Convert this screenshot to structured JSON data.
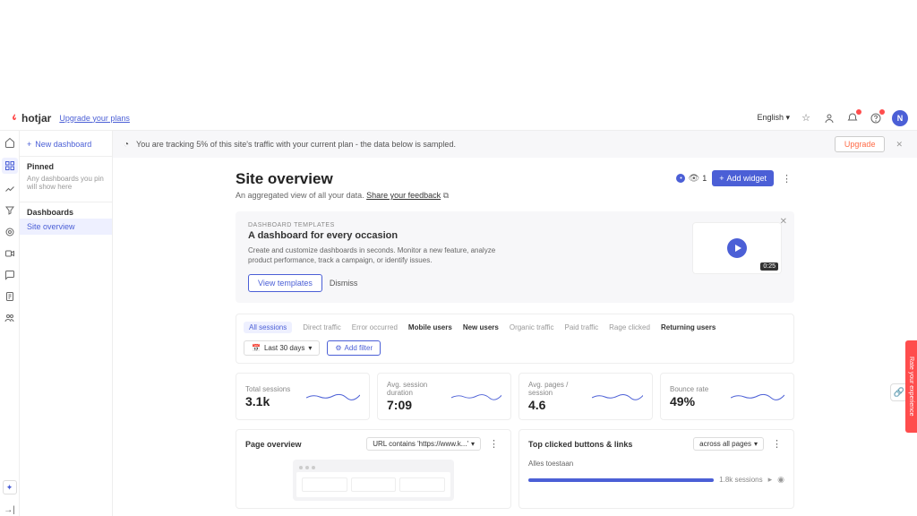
{
  "header": {
    "brand": "hotjar",
    "upgrade_link": "Upgrade your plans",
    "language": "English",
    "avatar_initial": "N"
  },
  "sidebar": {
    "new_dashboard": "New dashboard",
    "pinned_label": "Pinned",
    "pinned_note": "Any dashboards you pin will show here",
    "dashboards_label": "Dashboards",
    "items": [
      "Site overview"
    ]
  },
  "banner": {
    "text": "You are tracking 5% of this site's traffic with your current plan - the data below is sampled.",
    "upgrade": "Upgrade"
  },
  "page": {
    "title": "Site overview",
    "subtitle": "An aggregated view of all your data.",
    "feedback": "Share your feedback",
    "viewer_count": "1",
    "add_widget": "Add widget"
  },
  "promo": {
    "tag": "DASHBOARD TEMPLATES",
    "title": "A dashboard for every occasion",
    "desc": "Create and customize dashboards in seconds. Monitor a new feature, analyze product performance, track a campaign, or identify issues.",
    "view_templates": "View templates",
    "dismiss": "Dismiss",
    "video_duration": "0:25"
  },
  "tabs": {
    "items": [
      "All sessions",
      "Direct traffic",
      "Error occurred",
      "Mobile users",
      "New users",
      "Organic traffic",
      "Paid traffic",
      "Rage clicked",
      "Returning users"
    ],
    "active": 0,
    "bold": [
      3,
      4,
      8
    ]
  },
  "filter": {
    "date_label": "Last 30 days",
    "add_filter": "Add filter"
  },
  "metrics": [
    {
      "label": "Total sessions",
      "value": "3.1k"
    },
    {
      "label": "Avg. session duration",
      "value": "7:09"
    },
    {
      "label": "Avg. pages / session",
      "value": "4.6"
    },
    {
      "label": "Bounce rate",
      "value": "49%"
    }
  ],
  "page_overview": {
    "title": "Page overview",
    "url_filter": "URL contains 'https://www.k...'"
  },
  "top_clicked": {
    "title": "Top clicked buttons & links",
    "scope": "across all pages",
    "rows": [
      {
        "label": "Alles toestaan",
        "sessions": "1.8k sessions"
      }
    ]
  },
  "feedback_tab": "Rate your experience"
}
